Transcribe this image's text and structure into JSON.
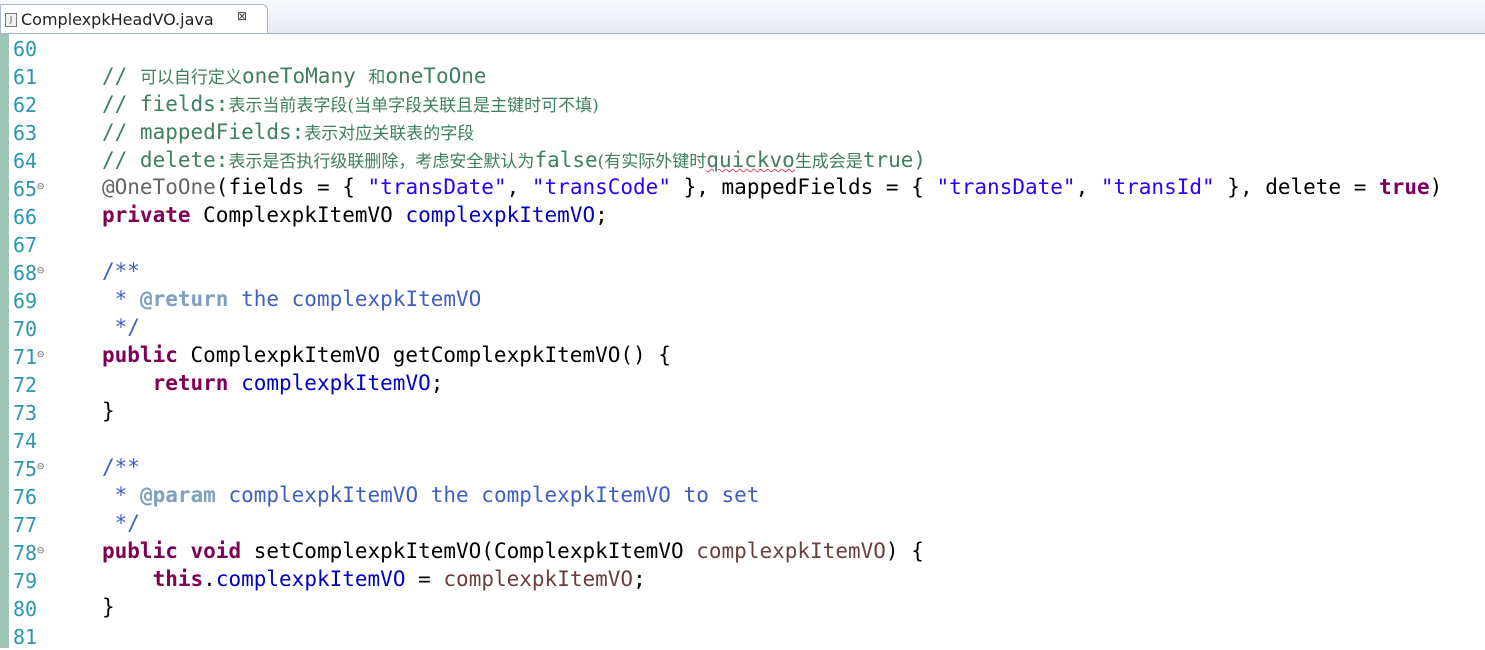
{
  "tab": {
    "filename": "ComplexpkHeadVO.java",
    "close": "⊠",
    "icon": "J"
  },
  "lines": [
    {
      "n": "60",
      "fold": false
    },
    {
      "n": "61",
      "fold": false
    },
    {
      "n": "62",
      "fold": false
    },
    {
      "n": "63",
      "fold": false
    },
    {
      "n": "64",
      "fold": false
    },
    {
      "n": "65",
      "fold": true
    },
    {
      "n": "66",
      "fold": false
    },
    {
      "n": "67",
      "fold": false
    },
    {
      "n": "68",
      "fold": true
    },
    {
      "n": "69",
      "fold": false
    },
    {
      "n": "70",
      "fold": false
    },
    {
      "n": "71",
      "fold": true
    },
    {
      "n": "72",
      "fold": false
    },
    {
      "n": "73",
      "fold": false
    },
    {
      "n": "74",
      "fold": false
    },
    {
      "n": "75",
      "fold": true
    },
    {
      "n": "76",
      "fold": false
    },
    {
      "n": "77",
      "fold": false
    },
    {
      "n": "78",
      "fold": true
    },
    {
      "n": "79",
      "fold": false
    },
    {
      "n": "80",
      "fold": false
    },
    {
      "n": "81",
      "fold": false
    }
  ],
  "fold_symbol": "⊖",
  "code": {
    "l61": [
      {
        "t": "// ",
        "c": "cmt"
      },
      {
        "t": "可以自行定义",
        "c": "cmt cn"
      },
      {
        "t": "oneToMany ",
        "c": "cmt"
      },
      {
        "t": "和",
        "c": "cmt cn"
      },
      {
        "t": "oneToOne",
        "c": "cmt"
      }
    ],
    "l62": [
      {
        "t": "// fields:",
        "c": "cmt"
      },
      {
        "t": "表示当前表字段(当单字段关联且是主键时可不填)",
        "c": "cmt cn"
      }
    ],
    "l63": [
      {
        "t": "// mappedFields:",
        "c": "cmt"
      },
      {
        "t": "表示对应关联表的字段",
        "c": "cmt cn"
      }
    ],
    "l64": [
      {
        "t": "// delete:",
        "c": "cmt"
      },
      {
        "t": "表示是否执行级联删除，考虑安全默认为",
        "c": "cmt cn"
      },
      {
        "t": "false",
        "c": "cmt"
      },
      {
        "t": "(有实际外键时",
        "c": "cmt cn"
      },
      {
        "t": "quickvo",
        "c": "cmt typo"
      },
      {
        "t": "生成会是",
        "c": "cmt cn"
      },
      {
        "t": "true)",
        "c": "cmt"
      }
    ],
    "l65": [
      {
        "t": "@OneToOne",
        "c": "ann"
      },
      {
        "t": "(fields = { ",
        "c": ""
      },
      {
        "t": "\"transDate\"",
        "c": "str"
      },
      {
        "t": ", ",
        "c": ""
      },
      {
        "t": "\"transCode\"",
        "c": "str"
      },
      {
        "t": " }, mappedFields = { ",
        "c": ""
      },
      {
        "t": "\"transDate\"",
        "c": "str"
      },
      {
        "t": ", ",
        "c": ""
      },
      {
        "t": "\"transId\"",
        "c": "str"
      },
      {
        "t": " }, delete = ",
        "c": ""
      },
      {
        "t": "true",
        "c": "kw"
      },
      {
        "t": ")",
        "c": ""
      }
    ],
    "l66": [
      {
        "t": "private",
        "c": "kw"
      },
      {
        "t": " ComplexpkItemVO ",
        "c": ""
      },
      {
        "t": "complexpkItemVO",
        "c": "fld"
      },
      {
        "t": ";",
        "c": ""
      }
    ],
    "l67": [],
    "l68": [
      {
        "t": "/**",
        "c": "doc"
      }
    ],
    "l69": [
      {
        "t": " * ",
        "c": "doc"
      },
      {
        "t": "@return",
        "c": "tag"
      },
      {
        "t": " the complexpkItemVO",
        "c": "doc"
      }
    ],
    "l70": [
      {
        "t": " */",
        "c": "doc"
      }
    ],
    "l71": [
      {
        "t": "public",
        "c": "kw"
      },
      {
        "t": " ComplexpkItemVO getComplexpkItemVO() {",
        "c": ""
      }
    ],
    "l72": [
      {
        "t": "    ",
        "c": ""
      },
      {
        "t": "return",
        "c": "kw"
      },
      {
        "t": " ",
        "c": ""
      },
      {
        "t": "complexpkItemVO",
        "c": "fld"
      },
      {
        "t": ";",
        "c": ""
      }
    ],
    "l73": [
      {
        "t": "}",
        "c": ""
      }
    ],
    "l74": [],
    "l75": [
      {
        "t": "/**",
        "c": "doc"
      }
    ],
    "l76": [
      {
        "t": " * ",
        "c": "doc"
      },
      {
        "t": "@param",
        "c": "tag"
      },
      {
        "t": " complexpkItemVO the complexpkItemVO to set",
        "c": "doc"
      }
    ],
    "l77": [
      {
        "t": " */",
        "c": "doc"
      }
    ],
    "l78": [
      {
        "t": "public",
        "c": "kw"
      },
      {
        "t": " ",
        "c": ""
      },
      {
        "t": "void",
        "c": "kw"
      },
      {
        "t": " setComplexpkItemVO(ComplexpkItemVO ",
        "c": ""
      },
      {
        "t": "complexpkItemVO",
        "c": "prm"
      },
      {
        "t": ") {",
        "c": ""
      }
    ],
    "l79": [
      {
        "t": "    ",
        "c": ""
      },
      {
        "t": "this",
        "c": "kw"
      },
      {
        "t": ".",
        "c": ""
      },
      {
        "t": "complexpkItemVO",
        "c": "fld"
      },
      {
        "t": " = ",
        "c": ""
      },
      {
        "t": "complexpkItemVO",
        "c": "prm"
      },
      {
        "t": ";",
        "c": ""
      }
    ],
    "l80": [
      {
        "t": "}",
        "c": ""
      }
    ],
    "l81": []
  },
  "colors": {
    "keyword": "#7f0055",
    "comment": "#3f7f5f",
    "javadoc": "#3f5fbf",
    "string": "#2a00ff",
    "field": "#0000c0",
    "line_number": "#2a96b0"
  }
}
